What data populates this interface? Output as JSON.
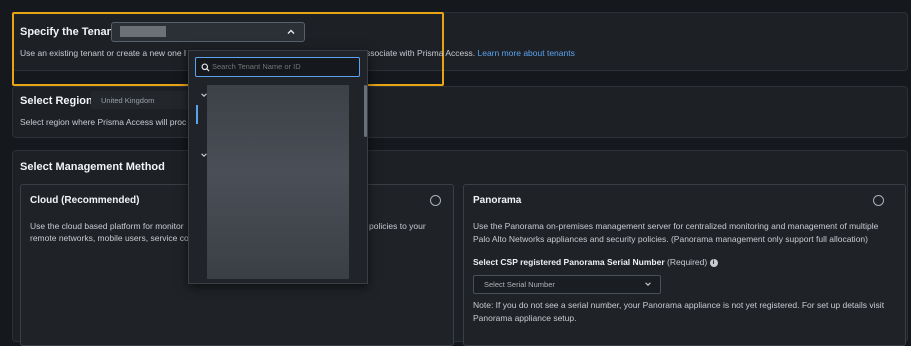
{
  "tenant": {
    "title": "Specify the Tenant",
    "desc_left": "Use an existing tenant or create a new one l",
    "desc_right": "ssociate with Prisma Access.",
    "link": "Learn more about tenants"
  },
  "dropdown": {
    "search_placeholder": "Search Tenant Name or ID"
  },
  "region": {
    "title": "Select Region",
    "value": "United Kingdom",
    "desc": "Select region where Prisma Access will proc"
  },
  "mgmt": {
    "title": "Select Management Method",
    "cloud": {
      "title": "Cloud (Recommended)",
      "line1": "Use the cloud based platform for monitor",
      "line1b": "policies to your",
      "line2": "remote networks, mobile users, service co"
    },
    "panorama": {
      "title": "Panorama",
      "line1": "Use the Panorama on-premises management server for centralized monitoring and management of multiple",
      "line2": "Palo Alto Networks appliances and security policies. (Panorama management only support full allocation)",
      "serial_label": "Select CSP registered Panorama Serial Number",
      "required": "(Required)",
      "serial_placeholder": "Select Serial Number",
      "note1": "Note: If you do not see a serial number, your Panorama appliance is not yet registered. For set up details visit",
      "note2": "Panorama appliance setup."
    }
  },
  "colors": {
    "highlight": "#e8a317",
    "link": "#5aa3f0",
    "focus": "#5aa3f0"
  }
}
